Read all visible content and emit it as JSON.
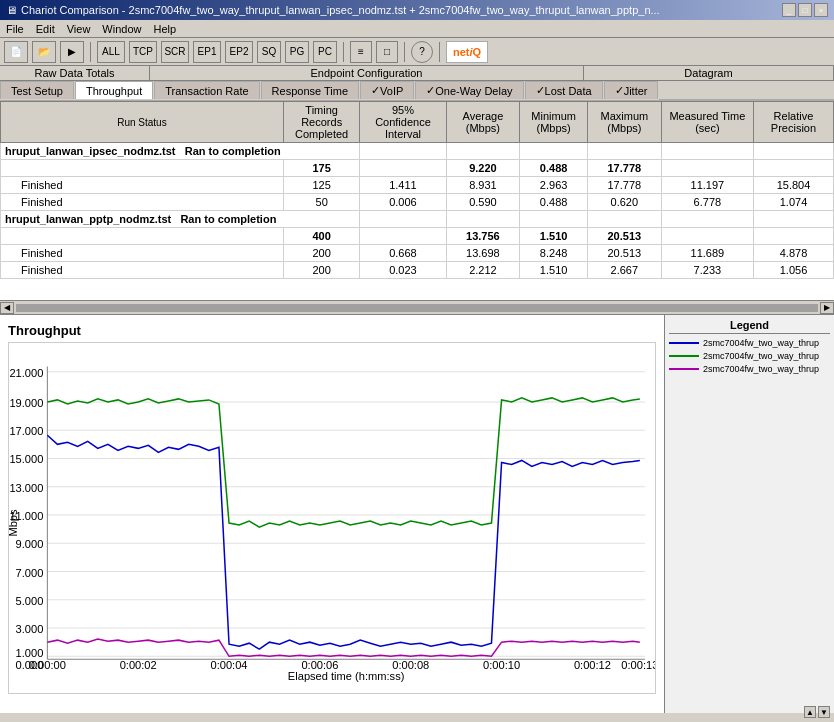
{
  "titleBar": {
    "title": "Chariot Comparison - 2smc7004fw_two_way_thruput_lanwan_ipsec_nodmz.tst + 2smc7004fw_two_way_thruput_lanwan_pptp_n...",
    "buttons": [
      "_",
      "□",
      "×"
    ]
  },
  "menuBar": {
    "items": [
      "File",
      "Edit",
      "View",
      "Window",
      "Help"
    ]
  },
  "toolbar": {
    "buttons": [
      "ALL",
      "TCP",
      "SCR",
      "EP1",
      "EP2",
      "SQ",
      "PG",
      "PC"
    ],
    "logoText": "net",
    "logoAccent": "iQ"
  },
  "topHeaders": {
    "rawData": "Raw Data Totals",
    "endpoint": "Endpoint Configuration",
    "datagram": "Datagram"
  },
  "subTabs": {
    "items": [
      "Test Setup",
      "Throughput",
      "Transaction Rate",
      "Response Time",
      "VoIP",
      "One-Way Delay",
      "Lost Data",
      "Jitter"
    ],
    "active": "Throughput"
  },
  "tableHeaders": {
    "runStatus": "Run Status",
    "timingRecords": "Timing Records Completed",
    "confidence": "95% Confidence Interval",
    "average": "Average (Mbps)",
    "minimum": "Minimum (Mbps)",
    "maximum": "Maximum (Mbps)",
    "measured": "Measured Time (sec)",
    "relPrecision": "Relative Precision"
  },
  "tableData": {
    "test1": {
      "name": "hruput_lanwan_ipsec_nodmz.tst",
      "status": "Ran to completion",
      "totalTiming": "175",
      "totalAvg": "9.220",
      "totalMin": "0.488",
      "totalMax": "17.778",
      "rows": [
        {
          "status": "Finished",
          "timing": "125",
          "ci": "1.411",
          "avg": "8.931",
          "min": "2.963",
          "max": "17.778",
          "mtime": "11.197",
          "rp": "15.804"
        },
        {
          "status": "Finished",
          "timing": "50",
          "ci": "0.006",
          "avg": "0.590",
          "min": "0.488",
          "max": "0.620",
          "mtime": "6.778",
          "rp": "1.074"
        }
      ]
    },
    "test2": {
      "name": "hruput_lanwan_pptp_nodmz.tst",
      "status": "Ran to completion",
      "totalTiming": "400",
      "totalAvg": "13.756",
      "totalMin": "1.510",
      "totalMax": "20.513",
      "rows": [
        {
          "status": "Finished",
          "timing": "200",
          "ci": "0.668",
          "avg": "13.698",
          "min": "8.248",
          "max": "20.513",
          "mtime": "11.689",
          "rp": "4.878"
        },
        {
          "status": "Finished",
          "timing": "200",
          "ci": "0.023",
          "avg": "2.212",
          "min": "1.510",
          "max": "2.667",
          "mtime": "7.233",
          "rp": "1.056"
        }
      ]
    }
  },
  "chart": {
    "title": "Throughput",
    "yAxisLabel": "Mbps",
    "xAxisLabel": "Elapsed time (h:mm:ss)",
    "yTicks": [
      "21.000",
      "19.000",
      "17.000",
      "15.000",
      "13.000",
      "11.000",
      "9.000",
      "7.000",
      "5.000",
      "3.000",
      "1.000",
      "0.000"
    ],
    "xTicks": [
      "0:00:00",
      "0:00:02",
      "0:00:04",
      "0:00:06",
      "0:00:08",
      "0:00:10",
      "0:00:12",
      "0:00:13"
    ]
  },
  "legend": {
    "title": "Legend",
    "items": [
      {
        "label": "2smc7004fw_two_way_thrup",
        "color": "#0000cc"
      },
      {
        "label": "2smc7004fw_two_way_thrup",
        "color": "#008800"
      },
      {
        "label": "2smc7004fw_two_way_thrup",
        "color": "#cc00cc"
      }
    ]
  }
}
